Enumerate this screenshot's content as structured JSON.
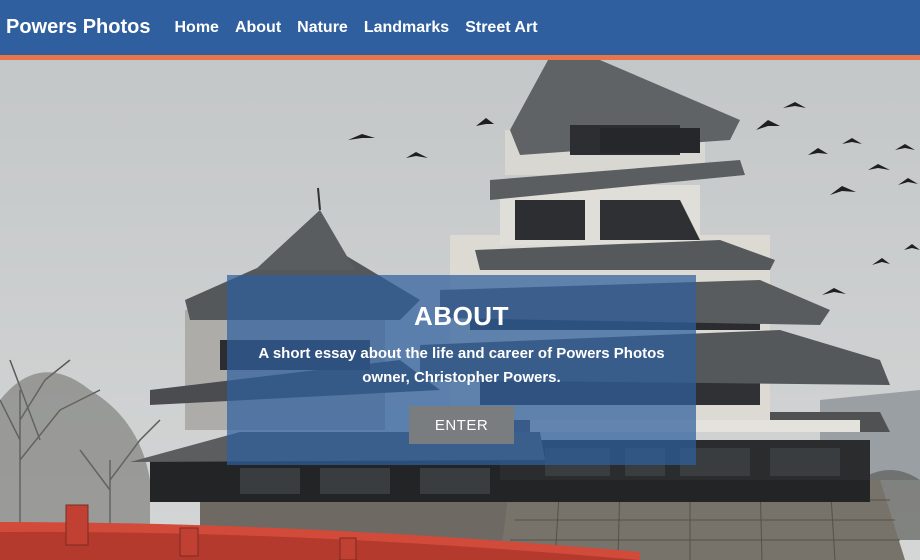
{
  "navbar": {
    "brand": "Powers Photos",
    "links": [
      "Home",
      "About",
      "Nature",
      "Landmarks",
      "Street Art"
    ]
  },
  "hero": {
    "image": "pagoda-castle-photo",
    "title": "ABOUT",
    "description": "A short essay about the life and career of Powers Photos owner, Christopher Powers.",
    "button_label": "ENTER"
  },
  "colors": {
    "navbar": "#2f5f9e",
    "accent": "#e8754a",
    "button": "#7a7d80"
  }
}
